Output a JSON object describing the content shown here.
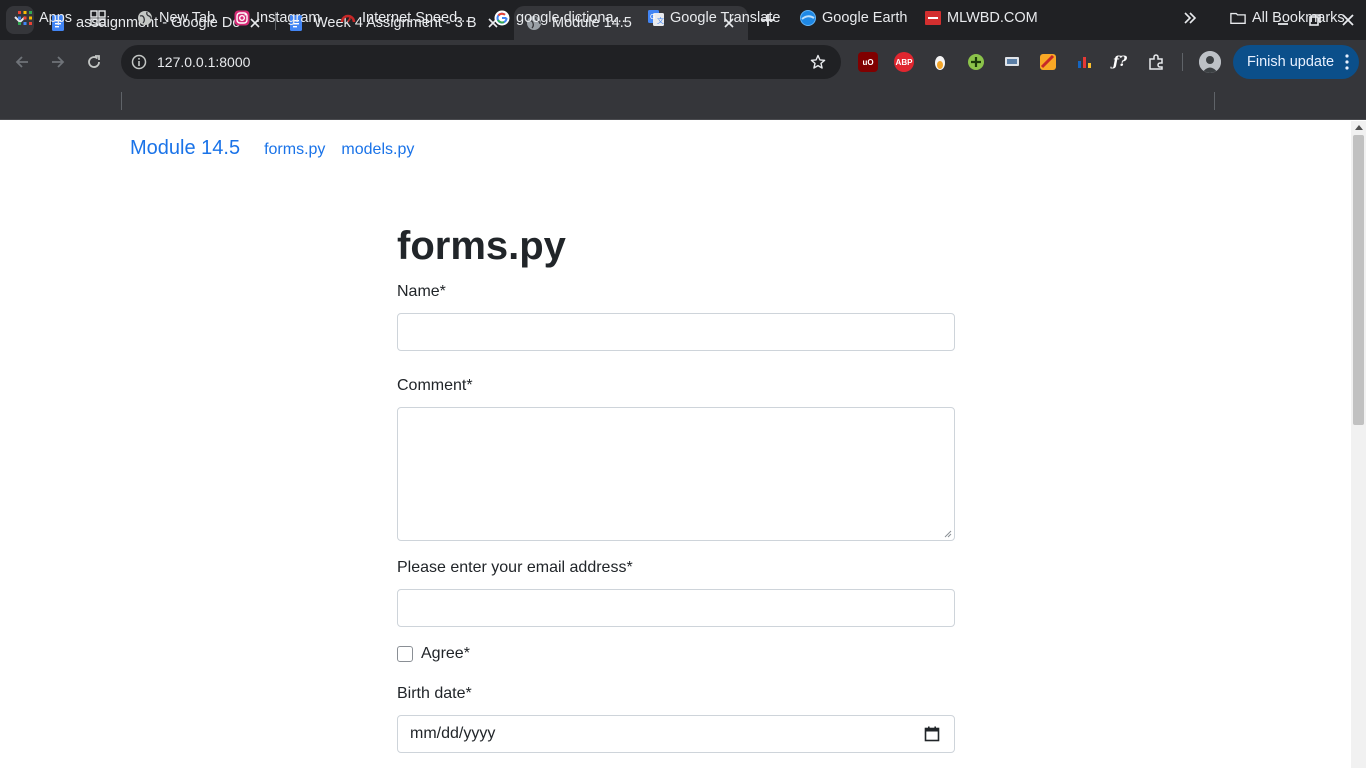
{
  "browser": {
    "tabs": [
      {
        "title": "assaignment - Google Do",
        "icon": "google-docs-icon",
        "active": false
      },
      {
        "title": "Week 4 Assignment - 3 B",
        "icon": "google-docs-icon",
        "active": false
      },
      {
        "title": "Module 14.5",
        "icon": "globe-icon",
        "active": true
      }
    ],
    "url": "127.0.0.1:8000",
    "finish_update": "Finish update",
    "extensions": [
      "ublock-origin-icon",
      "adblock-plus-icon",
      "extension-icon",
      "extension-icon",
      "extension-icon",
      "extension-icon",
      "extension-icon",
      "formula-extension-icon",
      "puzzle-extensions-icon"
    ],
    "bookmarks": [
      {
        "label": "Apps",
        "icon": "apps-grid-icon"
      },
      {
        "label": "",
        "icon": "tab-groups-icon"
      },
      {
        "label": "New Tab",
        "icon": "globe-icon"
      },
      {
        "label": "Instagram",
        "icon": "instagram-icon"
      },
      {
        "label": "Internet Speed...",
        "icon": "speedometer-icon"
      },
      {
        "label": "google dictiona...",
        "icon": "google-icon"
      },
      {
        "label": "Google Translate",
        "icon": "google-translate-icon"
      },
      {
        "label": "Google Earth",
        "icon": "google-earth-icon"
      },
      {
        "label": "MLWBD.COM",
        "icon": "mlwbd-icon"
      }
    ],
    "all_bookmarks": "All Bookmarks",
    "colors": {
      "accent": "#1a73e8",
      "finish_button": "#0b4f8a",
      "chrome_dark": "#202124",
      "chrome_toolbar": "#35363a"
    }
  },
  "page": {
    "brand": "Module 14.5",
    "nav": [
      "forms.py",
      "models.py"
    ],
    "heading": "forms.py",
    "fields": {
      "name_label": "Name*",
      "comment_label": "Comment*",
      "email_label": "Please enter your email address*",
      "agree_label": "Agree*",
      "birth_label": "Birth date*",
      "birth_placeholder": "mm/dd/yyyy"
    }
  }
}
